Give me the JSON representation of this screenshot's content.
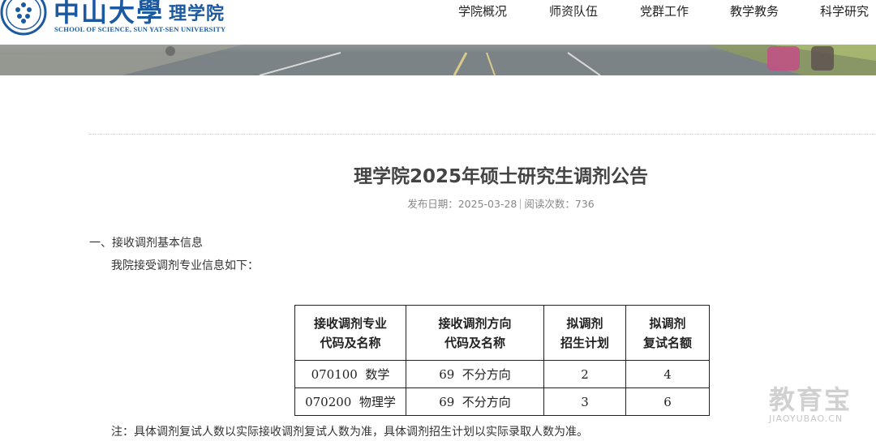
{
  "header": {
    "brand_cn": "中山大學",
    "brand_sub": "理学院",
    "brand_en": "SCHOOL OF SCIENCE, SUN YAT-SEN UNIVERSITY",
    "nav": [
      "学院概况",
      "师资队伍",
      "党群工作",
      "教学教务",
      "科学研究"
    ]
  },
  "article": {
    "title": "理学院2025年硕士研究生调剂公告",
    "publish_label": "发布日期：",
    "publish_date": "2025-03-28",
    "views_label": "阅读次数：",
    "views": "736",
    "section1_heading": "一、接收调剂基本信息",
    "section1_intro": "我院接受调剂专业信息如下：",
    "note": "注：具体调剂复试人数以实际接收调剂复试人数为准，具体调剂招生计划以实际录取人数为准。"
  },
  "table": {
    "headers": [
      [
        "接收调剂专业",
        "代码及名称"
      ],
      [
        "接收调剂方向",
        "代码及名称"
      ],
      [
        "拟调剂",
        "招生计划"
      ],
      [
        "拟调剂",
        "复试名额"
      ]
    ],
    "rows": [
      [
        "070100  数学",
        "69  不分方向",
        "2",
        "4"
      ],
      [
        "070200  物理学",
        "69  不分方向",
        "3",
        "6"
      ]
    ]
  },
  "watermark": {
    "cn": "教育宝",
    "en": "JIAOYUBAO.CN"
  },
  "colors": {
    "brand": "#1b5aa0",
    "text": "#333333",
    "meta": "#888888"
  }
}
